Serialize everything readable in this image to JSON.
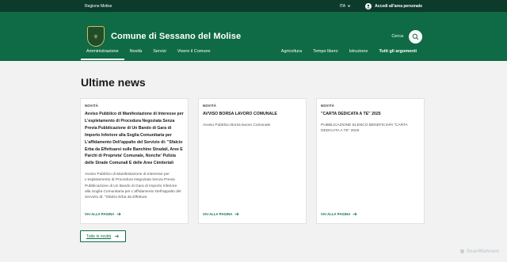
{
  "topbar": {
    "region": "Regione Molise",
    "lang": "ITA",
    "login": "Accedi all'area personale"
  },
  "header": {
    "title": "Comune di Sessano del Molise",
    "search_label": "Cerca"
  },
  "nav": {
    "left": [
      "Amministrazione",
      "Novità",
      "Servizi",
      "Vivere il Comune"
    ],
    "right": [
      "Agricoltura",
      "Tempo libero",
      "Istruzione"
    ],
    "all": "Tutti gli argomenti"
  },
  "section_title": "Ultime news",
  "cards": [
    {
      "category": "NOVITÀ",
      "title": "Avviso Pubblico di Manifestazione di Interesse per L'espletamento di Procedura Negoziata Senza Previa Pubblicazione di Un Bando di Gara di Importo Inferiore alla Soglia Comunitaria per L'affidamento Dell'appalto del Servizio di: \"Sfalcio Erba da Effettuarsi sulle Banchine Stradali, Aree E Parchi di Proprieta' Comunale, Nonche' Pulizia delle Strade Comunali E delle Aree Cimiteriali",
      "desc": "Avviso Pubblico di Manifestazione di Interesse per L'espletamento di Procedura Negoziata Senza Previa Pubblicazione di Un Bando di Gara di Importo Inferiore alla Soglia Comunitaria per L'affidamento Dell'appalto del Servizio di: \"Sfalcio Erba da Effettuar",
      "more": "VAI ALLA PAGINA"
    },
    {
      "category": "NOVITÀ",
      "title": "AVVISO BORSA LAVORO COMUNALE",
      "desc": "Avviso Pubblico Borsa lavoro Comunale",
      "more": "VAI ALLA PAGINA"
    },
    {
      "category": "NOVITÀ",
      "title": "\"CARTA DEDICATA A TE\" 2025",
      "desc": "PUBBLICAZIONE ELENCO BENEFICIARI \"CARTA DEDICATA A TE\" 2025",
      "more": "VAI ALLA PAGINA"
    }
  ],
  "all_news": "Tutte le novità",
  "watermark": "ScanMalware",
  "colors": {
    "topbar": "#0c3a2b",
    "primary": "#0f6b45",
    "background": "#f2f2f2"
  }
}
